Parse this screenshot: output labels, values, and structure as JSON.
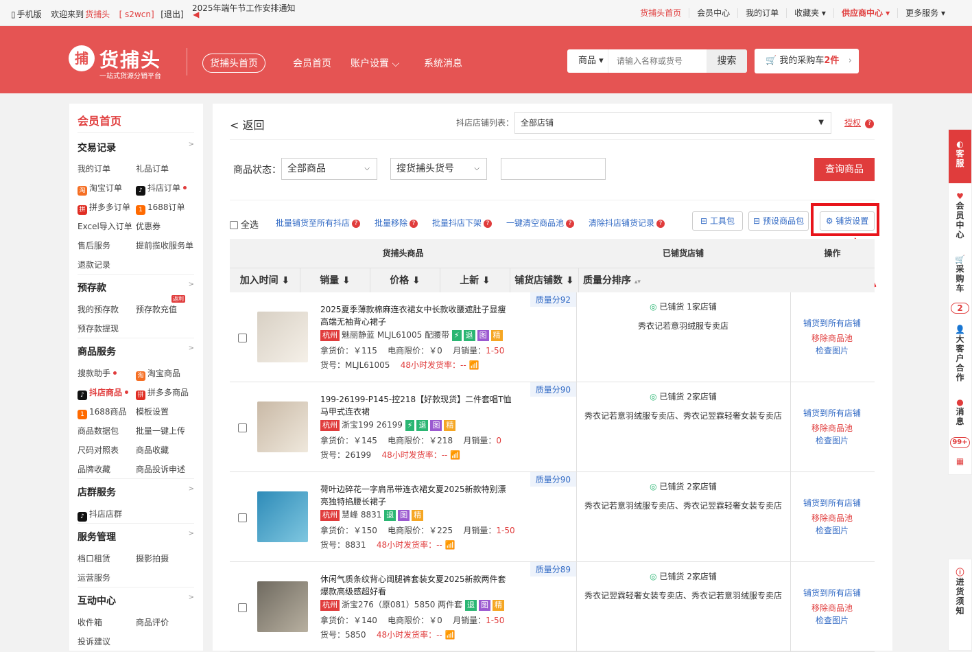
{
  "topbar": {
    "mobile": "手机版",
    "welcome_pre": "欢迎来到",
    "brand": "货捕头",
    "user": "[ s2wcn]",
    "logout": "[退出]",
    "notice": "2025年端午节工作安排通知",
    "links": [
      "货捕头首页",
      "会员中心",
      "我的订单",
      "收藏夹 ▾",
      "供应商中心 ▾",
      "更多服务 ▾"
    ]
  },
  "header": {
    "logo_char": "捕",
    "logo_name": "货捕头",
    "logo_sub": "一站式货源分销平台",
    "nav": [
      "货捕头首页",
      "会员首页",
      "账户设置 ⌵",
      "系统消息"
    ],
    "search_cat": "商品",
    "search_placeholder": "请输入名称或货号",
    "search_btn": "搜索",
    "cart_text": "我的采购车",
    "cart_count": "2件"
  },
  "sidebar": {
    "title": "会员首页",
    "sections": [
      {
        "name": "交易记录",
        "items": [
          "我的订单",
          "礼品订单",
          "淘宝订单",
          "抖店订单",
          "拼多多订单",
          "1688订单",
          "Excel导入订单",
          "优惠券",
          "售后服务",
          "提前揽收服务单",
          "退款记录"
        ]
      },
      {
        "name": "预存款",
        "items": [
          "我的预存款",
          "预存款充值",
          "预存款提现"
        ],
        "badge": "返利"
      },
      {
        "name": "商品服务",
        "items": [
          "搜款助手",
          "淘宝商品",
          "抖店商品",
          "拼多多商品",
          "1688商品",
          "模板设置",
          "商品数据包",
          "批量一键上传",
          "尺码对照表",
          "商品收藏",
          "品牌收藏",
          "商品投诉申述"
        ]
      },
      {
        "name": "店群服务",
        "items": [
          "抖店店群"
        ]
      },
      {
        "name": "服务管理",
        "items": [
          "档口租赁",
          "摄影拍摄",
          "运营服务"
        ]
      },
      {
        "name": "互动中心",
        "items": [
          "收件箱",
          "商品评价",
          "投诉建议"
        ]
      }
    ],
    "arrow": ">"
  },
  "main": {
    "back": "< 返回",
    "shop_list_label": "抖店店铺列表：",
    "shop_list_value": "全部店铺",
    "auth": "授权",
    "status_label": "商品状态：",
    "status_value": "全部商品",
    "search_type": "搜货捕头货号",
    "query_btn": "查询商品",
    "select_all": "全选",
    "actions": [
      "批量铺货至所有抖店",
      "批量移除",
      "批量抖店下架",
      "一键清空商品池",
      "清除抖店铺货记录"
    ],
    "tools": [
      "工具包",
      "预设商品包",
      "铺货设置"
    ],
    "table": {
      "group_headers": [
        "货捕头商品",
        "已铺货店铺",
        "操作"
      ],
      "col_headers": [
        "加入时间 ⬇",
        "销量 ⬇",
        "价格 ⬇",
        "上新 ⬇",
        "铺货店铺数 ⬇",
        "质量分排序"
      ],
      "rows": [
        {
          "title": "2025夏季薄款棉麻连衣裙女中长款收腰遮肚子显瘦高端无袖背心裙子",
          "city": "杭州",
          "seller": "魅丽静蓝 MLJL61005 配腰带",
          "tags": [
            "⚡",
            "退",
            "图",
            "精"
          ],
          "price": "拿货价：￥115",
          "limit": "电商限价：￥0",
          "sales_label": "月销量：",
          "sales": "1-50",
          "sku": "货号：MLJL61005",
          "rate": "48小时发货率：--",
          "quality": "质量分92",
          "shopped": "已铺货 1家店铺",
          "shops": "秀衣记若意羽绒服专卖店",
          "ops": [
            "铺货到所有店铺",
            "移除商品池",
            "检查图片"
          ]
        },
        {
          "title": "199-26199-P145-控218【好款现货】二件套唱T恤马甲式连衣裙",
          "city": "杭州",
          "seller": "浙宝199 26199",
          "tags": [
            "⚡",
            "退",
            "图",
            "精"
          ],
          "price": "拿货价：￥145",
          "limit": "电商限价：￥218",
          "sales_label": "月销量：",
          "sales": "0",
          "sku": "货号：26199",
          "rate": "48小时发货率：--",
          "quality": "质量分90",
          "shopped": "已铺货 2家店铺",
          "shops": "秀衣记若意羽绒服专卖店、秀衣记翌霖轻奢女装专卖店",
          "ops": [
            "铺货到所有店铺",
            "移除商品池",
            "检查图片"
          ]
        },
        {
          "title": "荷叶边碎花一字肩吊带连衣裙女夏2025新款特别漂亮独特掐腰长裙子",
          "city": "杭州",
          "seller": "慧峰 8831",
          "tags": [
            "退",
            "图",
            "精"
          ],
          "price": "拿货价：￥150",
          "limit": "电商限价：￥225",
          "sales_label": "月销量：",
          "sales": "1-50",
          "sku": "货号：8831",
          "rate": "48小时发货率：--",
          "quality": "质量分90",
          "shopped": "已铺货 2家店铺",
          "shops": "秀衣记若意羽绒服专卖店、秀衣记翌霖轻奢女装专卖店",
          "ops": [
            "铺货到所有店铺",
            "移除商品池",
            "检查图片"
          ]
        },
        {
          "title": "休闲气质条纹背心阔腿裤套装女夏2025新款两件套爆款高级感超好看",
          "city": "杭州",
          "seller": "浙宝276（原081）5850 两件套",
          "tags": [
            "退",
            "图",
            "精"
          ],
          "price": "拿货价：￥140",
          "limit": "电商限价：￥0",
          "sales_label": "月销量：",
          "sales": "1-50",
          "sku": "货号：5850",
          "rate": "48小时发货率：--",
          "quality": "质量分89",
          "shopped": "已铺货 2家店铺",
          "shops": "秀衣记翌霖轻奢女装专卖店、秀衣记若意羽绒服专卖店",
          "ops": [
            "铺货到所有店铺",
            "移除商品池",
            "检查图片"
          ]
        }
      ]
    }
  },
  "rightbar": [
    {
      "t": "客服"
    },
    {
      "t": "会员中心"
    },
    {
      "t": "采购车"
    },
    {
      "t": "2"
    },
    {
      "t": "大客户合作"
    },
    {
      "t": "消息"
    },
    {
      "t": "99+"
    },
    {
      "t": "进货须知"
    }
  ],
  "colors": {
    "brand": "#e55453",
    "accent": "#e03c3c",
    "link": "#3069c4"
  }
}
